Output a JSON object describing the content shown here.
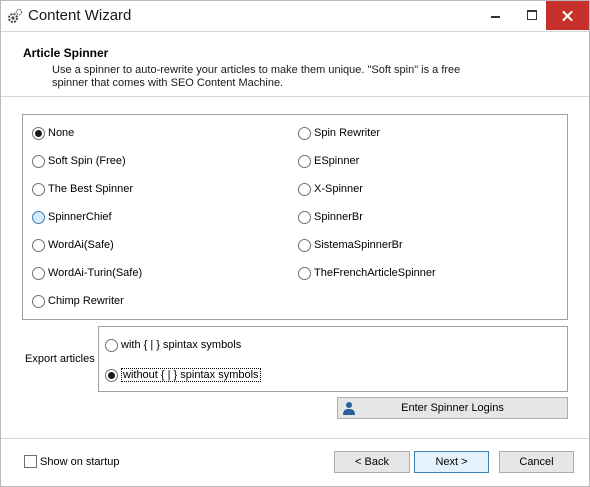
{
  "window": {
    "title": "Content Wizard",
    "icon": "gear-icon",
    "controls": {
      "minimize": "minimize-icon",
      "maximize": "maximize-icon",
      "close": "close-icon"
    },
    "close_color": "#c7312b"
  },
  "header": {
    "title": "Article Spinner",
    "description": "Use a spinner to auto-rewrite your articles to make them unique. \"Soft spin\" is a free spinner that comes with SEO Content Machine."
  },
  "spinners": {
    "left": [
      {
        "label": "None",
        "checked": true
      },
      {
        "label": "Soft Spin (Free)",
        "checked": false
      },
      {
        "label": "The Best Spinner",
        "checked": false
      },
      {
        "label": "SpinnerChief",
        "checked": false,
        "hover": true
      },
      {
        "label": "WordAi(Safe)",
        "checked": false
      },
      {
        "label": "WordAi-Turin(Safe)",
        "checked": false
      },
      {
        "label": "Chimp Rewriter",
        "checked": false
      }
    ],
    "right": [
      {
        "label": "Spin Rewriter",
        "checked": false
      },
      {
        "label": "ESpinner",
        "checked": false
      },
      {
        "label": "X-Spinner",
        "checked": false
      },
      {
        "label": "SpinnerBr",
        "checked": false
      },
      {
        "label": "SistemaSpinnerBr",
        "checked": false
      },
      {
        "label": "TheFrenchArticleSpinner",
        "checked": false
      }
    ]
  },
  "export": {
    "label": "Export articles",
    "options": [
      {
        "label": "with { | } spintax symbols",
        "checked": false
      },
      {
        "label": "without { | } spintax symbols",
        "checked": true
      }
    ]
  },
  "logins_button": {
    "label": "Enter Spinner Logins",
    "icon": "user-icon",
    "icon_color": "#2b5f9e"
  },
  "footer": {
    "show_on_startup": {
      "label": "Show on startup",
      "checked": false
    },
    "back_label": "< Back",
    "next_label": "Next >",
    "cancel_label": "Cancel"
  }
}
